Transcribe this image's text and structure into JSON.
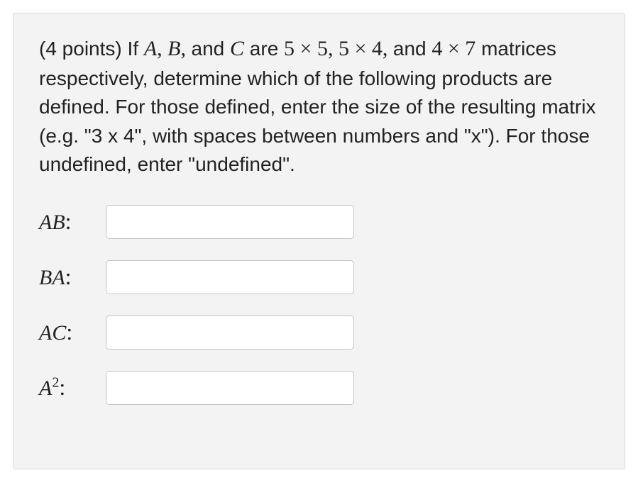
{
  "question": {
    "points_prefix": "(4 points) If ",
    "var_A": "A",
    "sep1": ", ",
    "var_B": "B",
    "sep2": ", ",
    "and1": "and ",
    "var_C": "C",
    "are": " are ",
    "dim1": "5 × 5",
    "sep3": ", ",
    "dim2": "5 × 4",
    "sep4": ", ",
    "and2": "and ",
    "dim3": "4 × 7",
    "rest": " matrices respectively, determine which of the following products are defined. For those defined, enter the size of the resulting matrix (e.g. \"3 x 4\", with spaces between numbers and \"x\"). For those undefined, enter \"undefined\"."
  },
  "rows": [
    {
      "label_html": "AB",
      "colon": ":",
      "value": ""
    },
    {
      "label_html": "BA",
      "colon": ":",
      "value": ""
    },
    {
      "label_html": "AC",
      "colon": ":",
      "value": ""
    },
    {
      "label_html": "A2",
      "colon": ":",
      "value": ""
    }
  ]
}
